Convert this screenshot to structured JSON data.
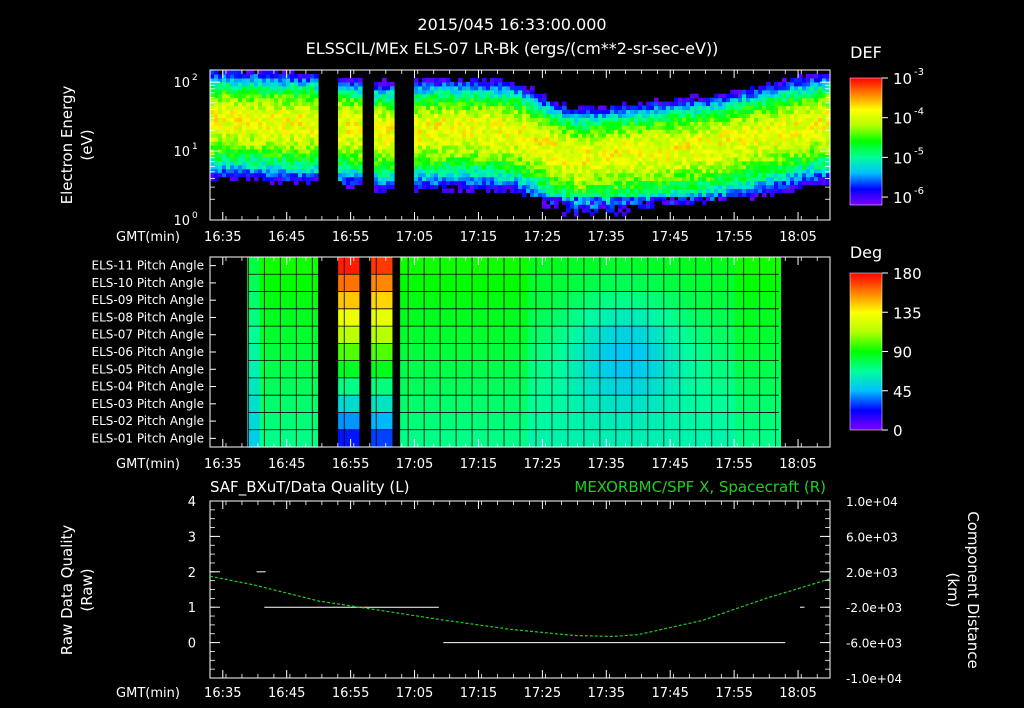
{
  "header": {
    "timestamp": "2015/045 16:33:00.000",
    "title": "ELSSCIL/MEx ELS-07 LR-Bk  (ergs/(cm**2-sr-sec-eV))"
  },
  "x_axis": {
    "label": "GMT(min)",
    "ticks": [
      "16:35",
      "16:45",
      "16:55",
      "17:05",
      "17:15",
      "17:25",
      "17:35",
      "17:45",
      "17:55",
      "18:05"
    ],
    "tick_minutes": [
      995,
      1005,
      1015,
      1025,
      1035,
      1045,
      1055,
      1065,
      1075,
      1085
    ],
    "range_minutes": [
      993,
      1090
    ]
  },
  "colors": {
    "spectrum": [
      "#7f00ff",
      "#0000ff",
      "#00bfff",
      "#00ff99",
      "#00ff00",
      "#b3ff00",
      "#ffff00",
      "#ff8000",
      "#ff0000"
    ],
    "series_green": "#22cc22",
    "dq_white": "#ffffff"
  },
  "chart_data": [
    {
      "type": "heatmap",
      "name": "energy-spectrogram",
      "ylabel_line1": "Electron Energy",
      "ylabel_line2": "(eV)",
      "y_scale": "log",
      "ylim": [
        1,
        150
      ],
      "y_ticks": [
        {
          "base": "10",
          "exp": "0"
        },
        {
          "base": "10",
          "exp": "1"
        },
        {
          "base": "10",
          "exp": "2"
        }
      ],
      "y_tick_values": [
        1,
        10,
        100
      ],
      "colorbar": {
        "title": "DEF",
        "labels": [
          {
            "base": "10",
            "exp": "-3"
          },
          {
            "base": "10",
            "exp": "-4"
          },
          {
            "base": "10",
            "exp": "-5"
          },
          {
            "base": "10",
            "exp": "-6"
          }
        ],
        "label_values": [
          -3,
          -4,
          -5,
          -6
        ],
        "range": [
          -6.2,
          -3
        ]
      },
      "data_gaps_minutes": [
        [
          1010,
          1013
        ],
        [
          1016.5,
          1018.5
        ],
        [
          1021.5,
          1025
        ]
      ],
      "peak_energy_by_time": {
        "x": [
          993,
          1000,
          1010,
          1020,
          1030,
          1040,
          1045,
          1050,
          1055,
          1060,
          1070,
          1080,
          1090
        ],
        "y": [
          30,
          28,
          26,
          20,
          22,
          20,
          12,
          8,
          9,
          10,
          12,
          18,
          28
        ]
      },
      "grid": false
    },
    {
      "type": "heatmap",
      "name": "pitch-angle",
      "categories": [
        "ELS-11 Pitch Angle",
        "ELS-10 Pitch Angle",
        "ELS-09 Pitch Angle",
        "ELS-08 Pitch Angle",
        "ELS-07 Pitch Angle",
        "ELS-06 Pitch Angle",
        "ELS-05 Pitch Angle",
        "ELS-04 Pitch Angle",
        "ELS-03 Pitch Angle",
        "ELS-02 Pitch Angle",
        "ELS-01 Pitch Angle"
      ],
      "colorbar": {
        "title": "Deg",
        "labels": [
          "180",
          "135",
          "90",
          "45",
          "0"
        ],
        "label_values": [
          180,
          135,
          90,
          45,
          0
        ],
        "range": [
          0,
          180
        ]
      },
      "data_span_minutes": [
        999,
        1082
      ],
      "data_gaps_minutes": [
        [
          1010,
          1013
        ],
        [
          1016.5,
          1018.5
        ],
        [
          1021.5,
          1023
        ]
      ],
      "grid": true
    },
    {
      "type": "line",
      "name": "data-quality-and-distance",
      "left_title": "SAF_BXuT/Data Quality (L)",
      "right_title": "MEXORBMC/SPF X, Spacecraft (R)",
      "ylabel_left_line1": "Raw Data Quality",
      "ylabel_left_line2": "(Raw)",
      "ylabel_right_line1": "Component Distance",
      "ylabel_right_line2": "(km)",
      "ylim_left": [
        -1,
        4
      ],
      "yticks_left": [
        "4",
        "3",
        "2",
        "1",
        "0"
      ],
      "yticks_left_values": [
        4,
        3,
        2,
        1,
        0
      ],
      "ylim_right": [
        -10000,
        10000
      ],
      "yticks_right": [
        "1.0e+04",
        "6.0e+03",
        "2.0e+03",
        "-2.0e+03",
        "-6.0e+03",
        "-1.0e+04"
      ],
      "yticks_right_values": [
        10000,
        6000,
        2000,
        -2000,
        -6000,
        -10000
      ],
      "series": [
        {
          "name": "SAF_BXuT/Data Quality (L)",
          "axis": "left",
          "segments": [
            {
              "x": [
                1000.3,
                1001.7
              ],
              "y": 2
            },
            {
              "x": [
                1001.5,
                1028.8
              ],
              "y": 1
            },
            {
              "x": [
                1029.5,
                1083.0
              ],
              "y": 0
            },
            {
              "x": [
                1085.3,
                1086.0
              ],
              "y": 1
            }
          ]
        },
        {
          "name": "MEXORBMC/SPF X, Spacecraft (R)",
          "axis": "right",
          "x": [
            993,
            1000,
            1010,
            1020,
            1030,
            1040,
            1050,
            1056,
            1060,
            1070,
            1080,
            1090
          ],
          "y": [
            1500,
            500,
            -1300,
            -2400,
            -3500,
            -4500,
            -5200,
            -5300,
            -5100,
            -3500,
            -1000,
            1200
          ]
        }
      ],
      "grid": false
    }
  ]
}
